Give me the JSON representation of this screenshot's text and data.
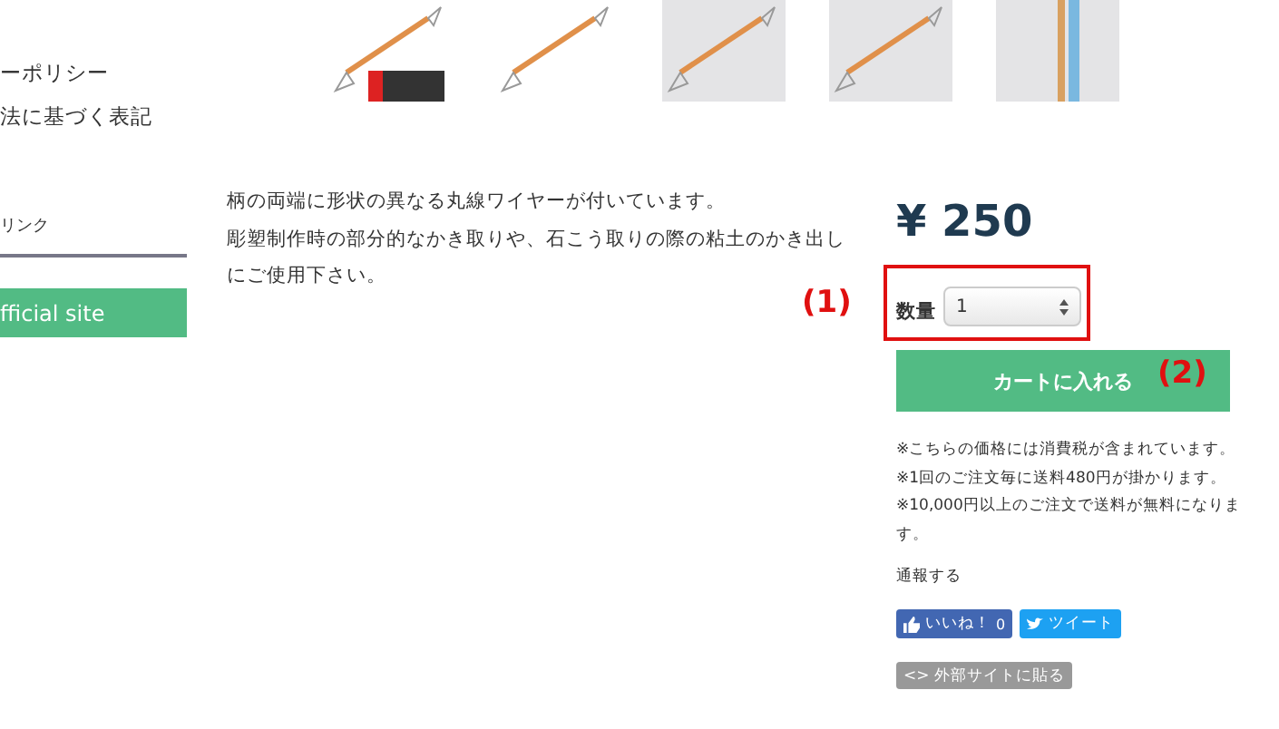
{
  "sidebar": {
    "links": [
      "ーポリシー",
      "法に基づく表記"
    ],
    "link_heading": "リンク",
    "official_button": "fficial site"
  },
  "thumbnails": [
    {
      "kind": "cutout_badge"
    },
    {
      "kind": "cutout"
    },
    {
      "kind": "photo"
    },
    {
      "kind": "photo"
    },
    {
      "kind": "ruler"
    }
  ],
  "description": [
    "柄の両端に形状の異なる丸線ワイヤーが付いています。",
    "彫塑制作時の部分的なかき取りや、石こう取りの際の粘土のかき出しにご使用下さい。"
  ],
  "price": "¥ 250",
  "quantity": {
    "label": "数量",
    "value": "1"
  },
  "cart_button": "カートに入れる",
  "notes": [
    "※こちらの価格には消費税が含まれています。",
    "※1回のご注文毎に送料480円が掛かります。",
    "※10,000円以上のご注文で送料が無料になります。"
  ],
  "report_link": "通報する",
  "like_button": {
    "label": "いいね！",
    "count": "0"
  },
  "tweet_button": "ツイート",
  "embed_button": "<> 外部サイトに貼る",
  "annotations": [
    "(1)",
    "(2)"
  ]
}
